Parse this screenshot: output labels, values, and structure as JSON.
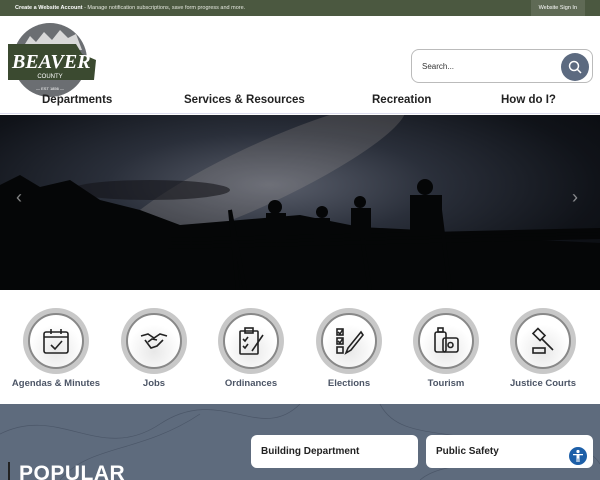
{
  "topbar": {
    "account_link": "Create a Website Account",
    "account_desc": " - Manage notification subscriptions, save form progress and more.",
    "signin": "Website Sign In"
  },
  "logo": {
    "text": "BEAVER",
    "sub": "COUNTY",
    "est": "EST 1856"
  },
  "search": {
    "placeholder": "Search..."
  },
  "nav": [
    "Departments",
    "Services & Resources",
    "Recreation",
    "How do I?"
  ],
  "quick_links": [
    "Agendas & Minutes",
    "Jobs",
    "Ordinances",
    "Elections",
    "Tourism",
    "Justice Courts"
  ],
  "popular": {
    "title": "POPULAR",
    "buttons": [
      "Building Department",
      "Public Safety"
    ]
  },
  "colors": {
    "topbar": "#4b5840",
    "accent": "#5c6a80",
    "popular_bg": "#5e6b7d"
  }
}
